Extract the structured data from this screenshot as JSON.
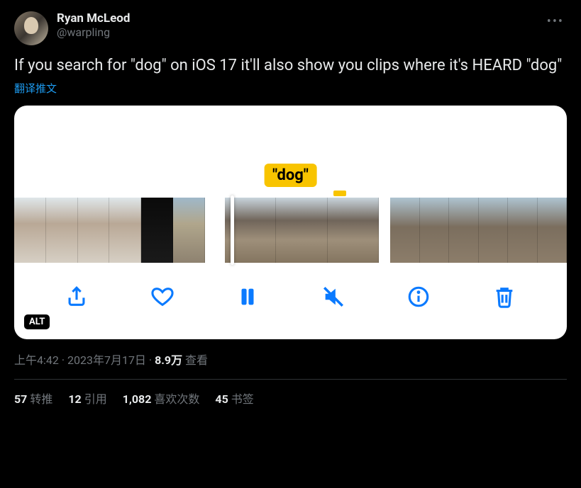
{
  "author": {
    "display_name": "Ryan McLeod",
    "handle": "@warpling"
  },
  "body": "If you search for \"dog\" on iOS 17 it'll also show you clips where it's HEARD \"dog\"",
  "translate_label": "翻译推文",
  "media": {
    "caption_pill": "\"dog\"",
    "alt_badge": "ALT",
    "toolbar": {
      "share": "share-icon",
      "like": "heart-icon",
      "pause": "pause-icon",
      "mute": "mute-icon",
      "info": "info-icon",
      "delete": "trash-icon"
    }
  },
  "meta": {
    "time": "上午4:42",
    "dot1": " · ",
    "date": "2023年7月17日",
    "dot2": " · ",
    "views_count": "8.9万",
    "views_label": " 查看"
  },
  "stats": {
    "retweets_n": "57",
    "retweets_l": "转推",
    "quotes_n": "12",
    "quotes_l": "引用",
    "likes_n": "1,082",
    "likes_l": "喜欢次数",
    "bookmarks_n": "45",
    "bookmarks_l": "书签"
  }
}
